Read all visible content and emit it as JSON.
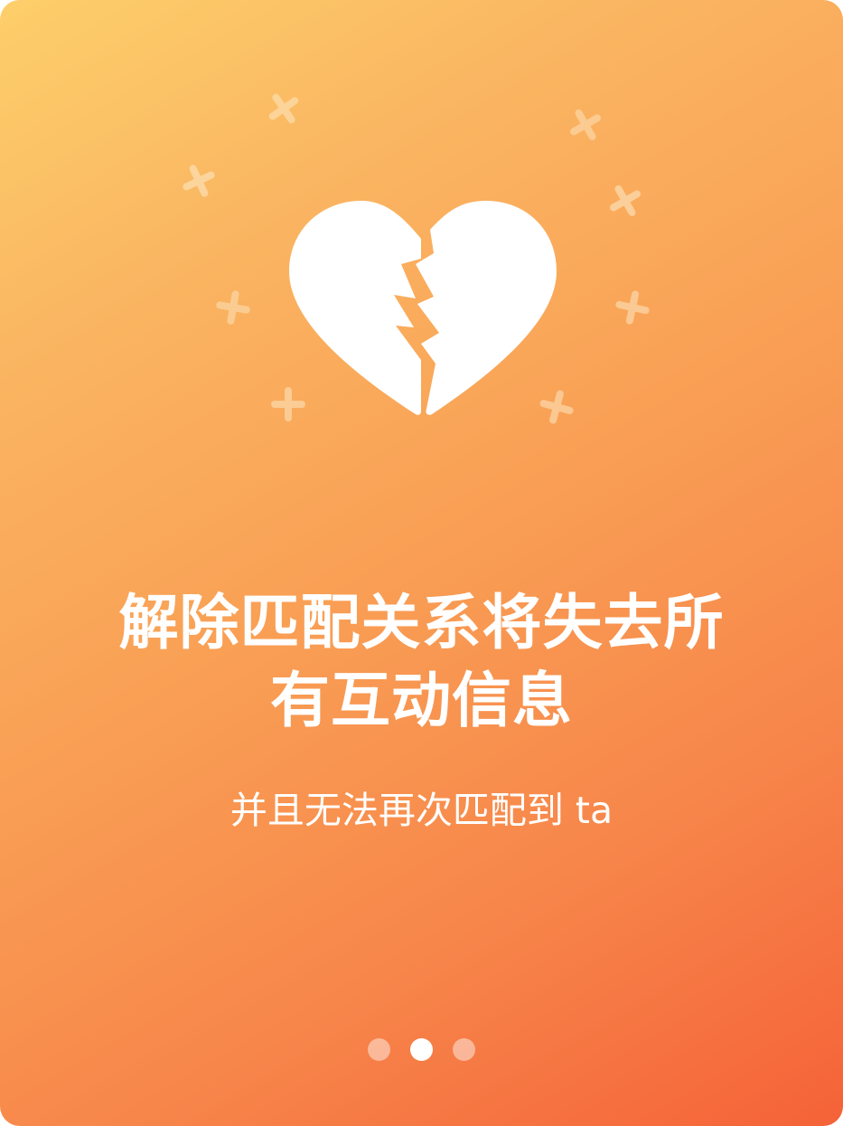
{
  "title": {
    "line1": "解除匹配关系将失去所",
    "line2": "有互动信息"
  },
  "subtitle": "并且无法再次匹配到 ta",
  "illustration": {
    "main_icon": "broken-heart-icon",
    "decorations": "cross-sparkle-icon"
  },
  "pagination": {
    "total": 3,
    "active_index": 1
  },
  "colors": {
    "gradient_start": "#fdcf6a",
    "gradient_end": "#f56238",
    "text": "#ffffff"
  }
}
